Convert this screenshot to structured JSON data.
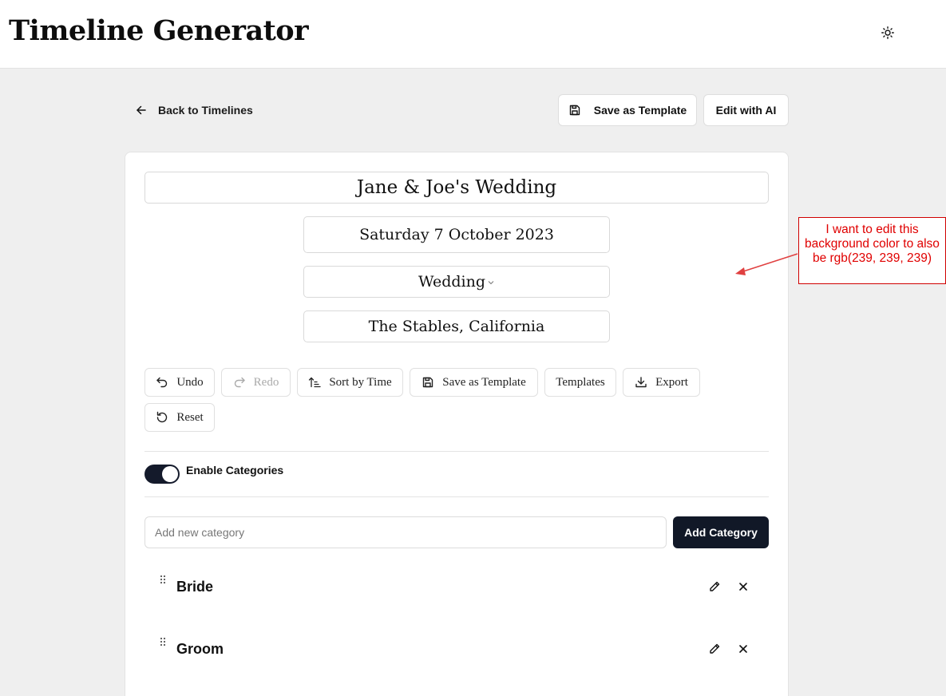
{
  "header": {
    "title": "Timeline Generator",
    "theme_icon": "sun-icon"
  },
  "nav": {
    "back_label": "Back to Timelines",
    "save_template_label": "Save as Template",
    "edit_ai_label": "Edit with AI"
  },
  "timeline": {
    "title": "Jane & Joe's Wedding",
    "date": "Saturday 7 October 2023",
    "type": "Wedding",
    "location": "The Stables, California"
  },
  "toolbar": {
    "undo": "Undo",
    "redo": "Redo",
    "sort": "Sort by Time",
    "save_template": "Save as Template",
    "templates": "Templates",
    "export": "Export",
    "reset": "Reset"
  },
  "categories": {
    "toggle_label": "Enable Categories",
    "enabled": true,
    "input_placeholder": "Add new category",
    "add_button": "Add Category",
    "items": [
      {
        "name": "Bride"
      },
      {
        "name": "Groom"
      }
    ]
  },
  "annotation": {
    "text": "I want to edit this background color to also be rgb(239, 239, 239)",
    "color": "#e00000"
  },
  "colors": {
    "page_background": "#efefef",
    "primary_button": "#111827"
  }
}
